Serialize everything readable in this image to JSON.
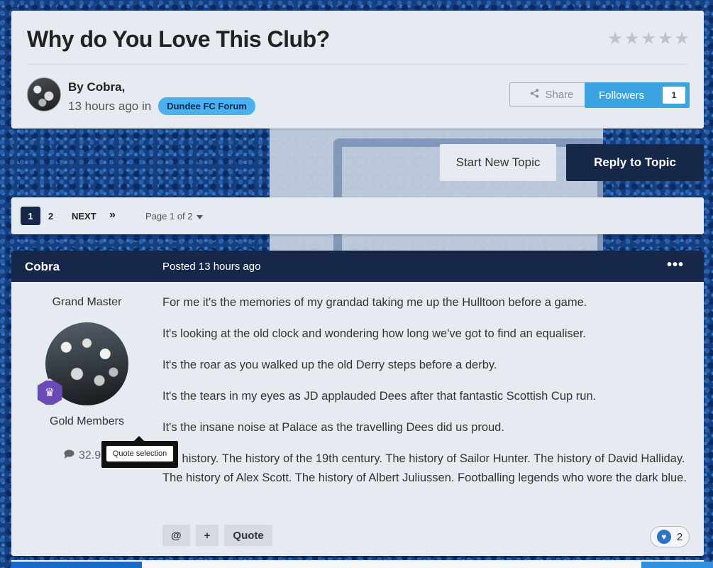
{
  "topic": {
    "title": "Why do You Love This Club?",
    "rating_stars": 5,
    "author_by": "By Cobra,",
    "posted_ago": "13 hours ago in",
    "forum": "Dundee FC Forum",
    "share_label": "Share",
    "followers_label": "Followers",
    "followers_count": "1"
  },
  "actions": {
    "start_new_topic": "Start New Topic",
    "reply_to_topic": "Reply to Topic"
  },
  "pagination": {
    "current": "1",
    "page_two": "2",
    "next": "NEXT",
    "last": "»",
    "page_of": "Page 1 of 2"
  },
  "post": {
    "author": "Cobra",
    "posted": "Posted 13 hours ago",
    "menu": "•••",
    "rank": "Grand Master",
    "group": "Gold Members",
    "post_count": "32.9",
    "quote_selection": "Quote selection",
    "paragraphs": [
      "For me it's the memories of my grandad taking me up the Hulltoon before a game.",
      "It's looking at the old clock and wondering how long we've got to find an equaliser.",
      "It's the roar as you walked up the old Derry steps before a derby.",
      "It's the tears in my eyes as JD applauded Dees after that fantastic Scottish Cup run.",
      "It's the insane noise at Palace as the travelling Dees did us proud.",
      "the history. The history of the 19th century. The history of Sailor Hunter. The history of David Halliday. The history of Alex Scott. The history of Albert Juliussen. Footballing legends who wore the dark blue."
    ],
    "mention_label": "@",
    "multiquote_label": "+",
    "quote_label": "Quote",
    "reaction_count": "2"
  },
  "icons": {
    "star": "star-icon",
    "share": "share-icon",
    "comment": "comment-icon",
    "heart": "heart-icon",
    "crown": "crown-icon",
    "caret": "caret-down-icon"
  },
  "colors": {
    "dark_navy": "#17274a",
    "accent_blue": "#3aa3e0",
    "badge_blue": "#4bb0f0",
    "card_bg": "#e6eaf1"
  }
}
